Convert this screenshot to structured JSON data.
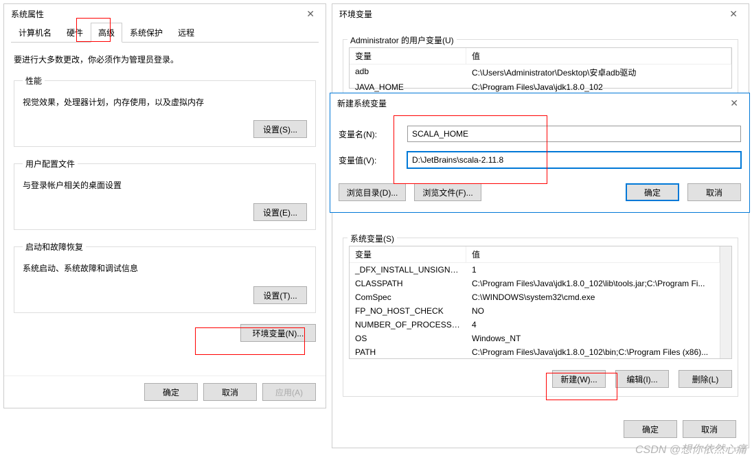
{
  "sys_props": {
    "title": "系统属性",
    "tabs": [
      "计算机名",
      "硬件",
      "高级",
      "系统保护",
      "远程"
    ],
    "active_tab": 2,
    "instruction": "要进行大多数更改，你必须作为管理员登录。",
    "perf": {
      "legend": "性能",
      "desc": "视觉效果，处理器计划，内存使用，以及虚拟内存",
      "btn": "设置(S)..."
    },
    "userprof": {
      "legend": "用户配置文件",
      "desc": "与登录帐户相关的桌面设置",
      "btn": "设置(E)..."
    },
    "startup": {
      "legend": "启动和故障恢复",
      "desc": "系统启动、系统故障和调试信息",
      "btn": "设置(T)..."
    },
    "env_btn": "环境变量(N)...",
    "ok": "确定",
    "cancel": "取消",
    "apply": "应用(A)"
  },
  "env": {
    "title": "环境变量",
    "user_group": "Administrator 的用户变量(U)",
    "header_var": "变量",
    "header_val": "值",
    "user_rows": [
      {
        "var": "adb",
        "val": "C:\\Users\\Administrator\\Desktop\\安卓adb驱动"
      },
      {
        "var": "JAVA_HOME",
        "val": "C:\\Program Files\\Java\\jdk1.8.0_102"
      }
    ],
    "sys_group": "系统变量(S)",
    "sys_rows": [
      {
        "var": "_DFX_INSTALL_UNSIGNED...",
        "val": "1"
      },
      {
        "var": "CLASSPATH",
        "val": "C:\\Program Files\\Java\\jdk1.8.0_102\\lib\\tools.jar;C:\\Program Fi..."
      },
      {
        "var": "ComSpec",
        "val": "C:\\WINDOWS\\system32\\cmd.exe"
      },
      {
        "var": "FP_NO_HOST_CHECK",
        "val": "NO"
      },
      {
        "var": "NUMBER_OF_PROCESSORS",
        "val": "4"
      },
      {
        "var": "OS",
        "val": "Windows_NT"
      },
      {
        "var": "PATH",
        "val": "C:\\Program Files\\Java\\jdk1.8.0_102\\bin;C:\\Program Files (x86)..."
      }
    ],
    "new_btn": "新建(W)...",
    "edit_btn": "编辑(I)...",
    "del_btn": "删除(L)",
    "ok": "确定",
    "cancel": "取消"
  },
  "new_var": {
    "title": "新建系统变量",
    "name_label": "变量名(N):",
    "name_value": "SCALA_HOME",
    "val_label": "变量值(V):",
    "val_value": "D:\\JetBrains\\scala-2.11.8",
    "browse_dir": "浏览目录(D)...",
    "browse_file": "浏览文件(F)...",
    "ok": "确定",
    "cancel": "取消"
  },
  "watermark": "CSDN @想你依然心痛"
}
